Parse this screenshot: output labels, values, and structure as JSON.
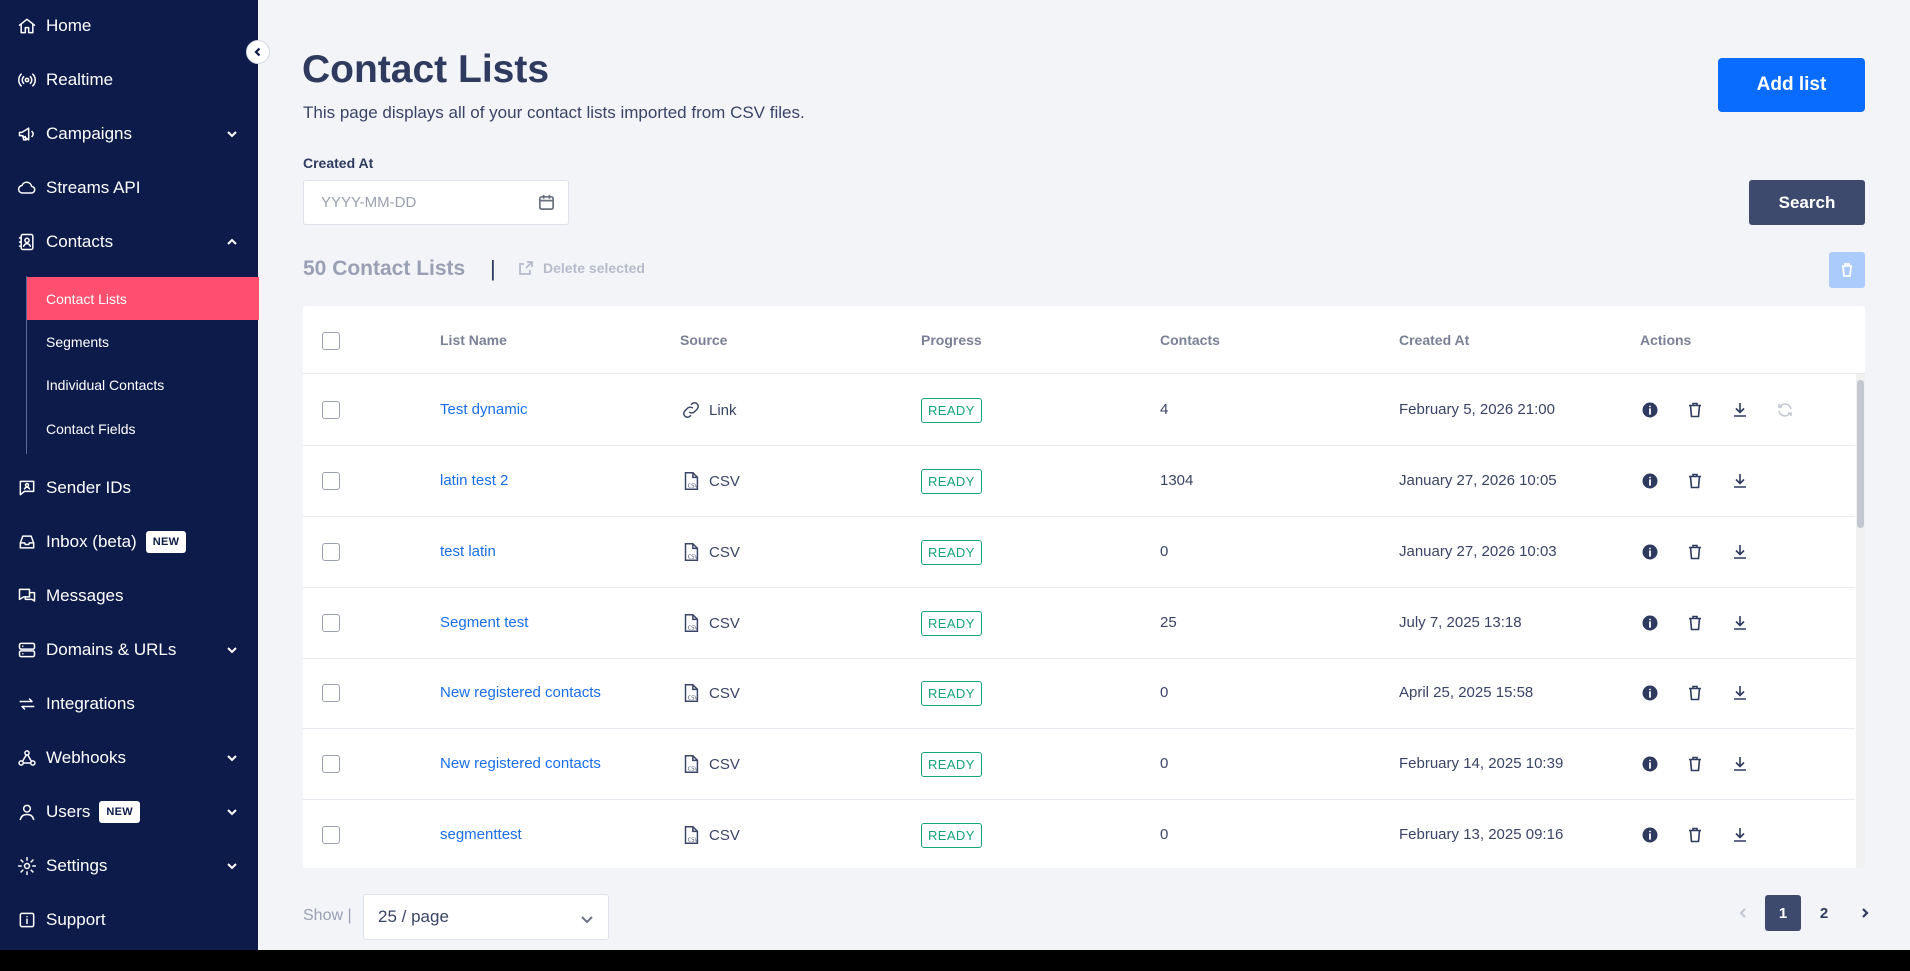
{
  "sidebar": {
    "items": [
      {
        "label": "Home"
      },
      {
        "label": "Realtime"
      },
      {
        "label": "Campaigns"
      },
      {
        "label": "Streams API"
      },
      {
        "label": "Contacts"
      },
      {
        "label": "Sender IDs"
      },
      {
        "label": "Inbox (beta)",
        "badge": "NEW"
      },
      {
        "label": "Messages"
      },
      {
        "label": "Domains & URLs"
      },
      {
        "label": "Integrations"
      },
      {
        "label": "Webhooks"
      },
      {
        "label": "Users",
        "badge": "NEW"
      },
      {
        "label": "Settings"
      },
      {
        "label": "Support"
      }
    ],
    "contacts_sub": [
      {
        "label": "Contact Lists",
        "active": true
      },
      {
        "label": "Segments"
      },
      {
        "label": "Individual Contacts"
      },
      {
        "label": "Contact Fields"
      }
    ]
  },
  "header": {
    "title": "Contact Lists",
    "subtitle": "This page displays all of your contact lists imported from CSV files.",
    "add_label": "Add list"
  },
  "filter": {
    "created_label": "Created At",
    "date_placeholder": "YYYY-MM-DD",
    "search_label": "Search"
  },
  "summary": {
    "count_label": "50 Contact Lists",
    "separator": "|",
    "delete_selected": "Delete selected"
  },
  "table": {
    "columns": [
      "List Name",
      "Source",
      "Progress",
      "Contacts",
      "Created At",
      "Actions"
    ],
    "rows": [
      {
        "name": "Test dynamic",
        "source": "Link",
        "status": "READY",
        "contacts": "4",
        "created": "February 5, 2026 21:00",
        "refresh": true
      },
      {
        "name": "latin test 2",
        "source": "CSV",
        "status": "READY",
        "contacts": "1304",
        "created": "January 27, 2026 10:05"
      },
      {
        "name": "test latin",
        "source": "CSV",
        "status": "READY",
        "contacts": "0",
        "created": "January 27, 2026 10:03"
      },
      {
        "name": "Segment test",
        "source": "CSV",
        "status": "READY",
        "contacts": "25",
        "created": "July 7, 2025 13:18"
      },
      {
        "name": "New registered contacts",
        "source": "CSV",
        "status": "READY",
        "contacts": "0",
        "created": "April 25, 2025 15:58"
      },
      {
        "name": "New registered contacts",
        "source": "CSV",
        "status": "READY",
        "contacts": "0",
        "created": "February 14, 2025 10:39"
      },
      {
        "name": "segmenttest",
        "source": "CSV",
        "status": "READY",
        "contacts": "0",
        "created": "February 13, 2025 09:16"
      }
    ]
  },
  "footer": {
    "show_label": "Show |",
    "page_size": "25 / page",
    "pages": [
      "1",
      "2"
    ],
    "current_page": "1"
  },
  "colors": {
    "sidebar_bg": "#0d1b4a",
    "active_item": "#ff4f6e",
    "primary_button": "#0a6cff",
    "dark_button": "#3d4a6e",
    "ready_status": "#15a37a",
    "link": "#1a6ee8"
  },
  "icons": {
    "home": "home-icon",
    "realtime": "broadcast-icon",
    "campaigns": "megaphone-icon",
    "streams": "cloud-icon",
    "contacts": "contact-book-icon",
    "sender": "message-id-icon",
    "inbox": "inbox-icon",
    "messages": "messages-icon",
    "domains": "server-icon",
    "integrations": "sync-arrows-icon",
    "webhooks": "webhook-icon",
    "users": "user-icon",
    "settings": "gear-icon",
    "support": "info-icon"
  }
}
